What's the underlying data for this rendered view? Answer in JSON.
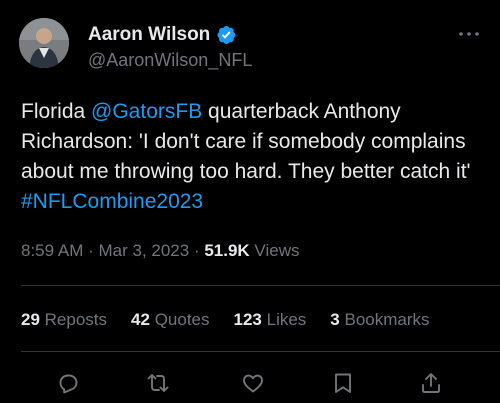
{
  "author": {
    "display_name": "Aaron Wilson",
    "handle": "@AaronWilson_NFL",
    "verified_icon": "verified-badge-icon",
    "avatar_icon": "profile-photo"
  },
  "tweet": {
    "text_1": "Florida ",
    "mention": "@GatorsFB",
    "text_2": " quarterback Anthony Richardson: 'I don't care if somebody complains about me throwing too hard. They better catch it' ",
    "hashtag": "#NFLCombine2023"
  },
  "meta": {
    "time": "8:59 AM",
    "sep1": " · ",
    "date": "Mar 3, 2023",
    "sep2": " · ",
    "views_count": "51.9K",
    "views_label": " Views"
  },
  "stats": [
    {
      "count": "29",
      "label": "Reposts"
    },
    {
      "count": "42",
      "label": "Quotes"
    },
    {
      "count": "123",
      "label": "Likes"
    },
    {
      "count": "3",
      "label": "Bookmarks"
    }
  ],
  "actions": {
    "reply": "reply-icon",
    "repost": "repost-icon",
    "like": "like-icon",
    "bookmark": "bookmark-icon",
    "share": "share-icon"
  },
  "colors": {
    "background": "#000000",
    "text": "#e7e9ea",
    "secondary": "#71767b",
    "accent": "#1d9bf0",
    "divider": "#2f3336"
  }
}
